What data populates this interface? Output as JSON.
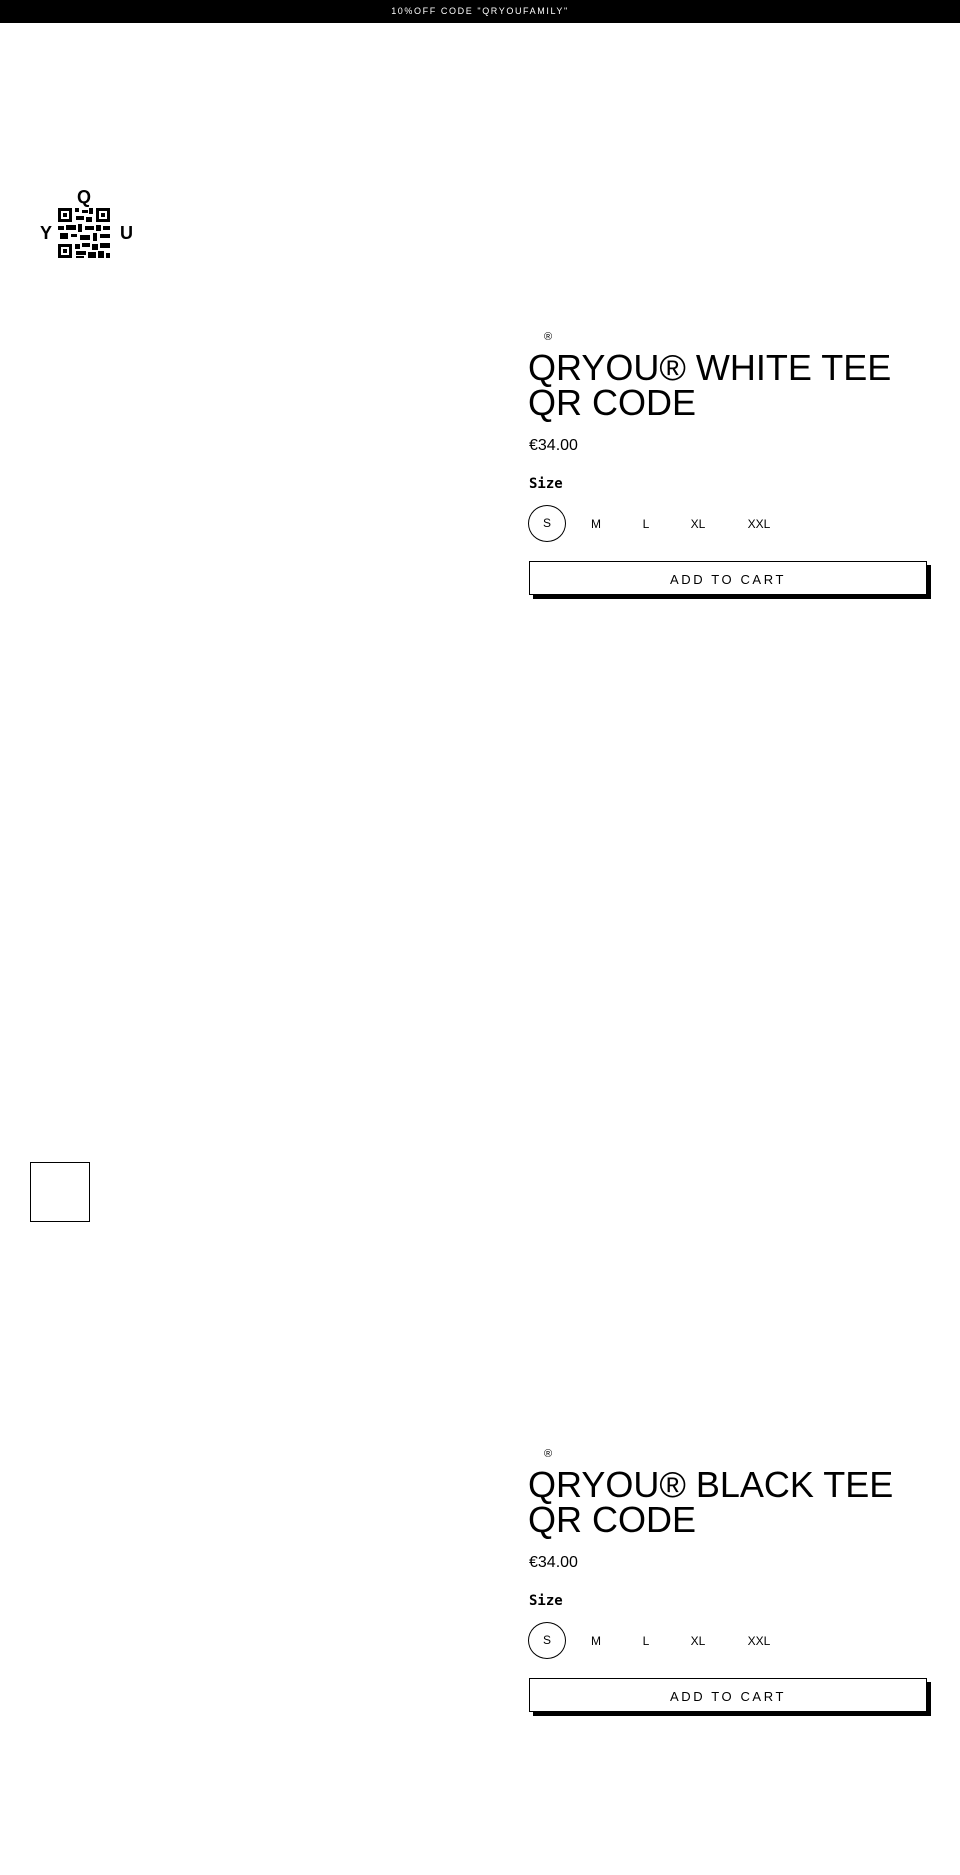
{
  "announcement": "10%OFF CODE \"QRYOUFAMILY\"",
  "logo": {
    "icon": "qryou-qr-logo",
    "letters": [
      "Q",
      "Y",
      "U"
    ]
  },
  "products": [
    {
      "mark": "®",
      "title": "QRYOU® WHITE TEE QR CODE",
      "price": "€34.00",
      "size_label": "Size",
      "sizes": [
        "S",
        "M",
        "L",
        "XL",
        "XXL"
      ],
      "selected_size": "S",
      "add_to_cart": "ADD TO CART"
    },
    {
      "mark": "®",
      "title": "QRYOU® BLACK TEE QR CODE",
      "price": "€34.00",
      "size_label": "Size",
      "sizes": [
        "S",
        "M",
        "L",
        "XL",
        "XXL"
      ],
      "selected_size": "S",
      "add_to_cart": "ADD TO CART"
    }
  ]
}
